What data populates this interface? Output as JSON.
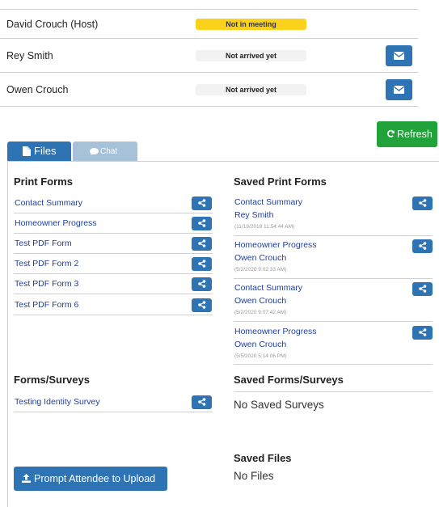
{
  "attendees": [
    {
      "name": "David Crouch (Host)",
      "status": "Not in meeting",
      "status_color": "#fbd21b",
      "has_mail": false
    },
    {
      "name": "Rey Smith",
      "status": "Not arrived yet",
      "status_color": "#f2f2f2",
      "has_mail": true
    },
    {
      "name": "Owen Crouch",
      "status": "Not arrived yet",
      "status_color": "#f2f2f2",
      "has_mail": true
    }
  ],
  "toolbar": {
    "refresh_label": "Refresh"
  },
  "tabs": [
    {
      "label": "Files",
      "icon": "file-icon",
      "active": true
    },
    {
      "label": "Chat",
      "icon": "chat-bubble-icon",
      "active": false
    }
  ],
  "print_forms": {
    "title": "Print Forms",
    "items": [
      "Contact Summary",
      "Homeowner Progress",
      "Test PDF Form",
      "Test PDF Form 2",
      "Test PDF Form 3",
      "Test PDF Form 6"
    ]
  },
  "saved_print_forms": {
    "title": "Saved Print Forms",
    "items": [
      {
        "form": "Contact Summary",
        "person": "Rey Smith",
        "timestamp": "(11/19/2019 11:54:44 AM)"
      },
      {
        "form": "Homeowner Progress",
        "person": "Owen Crouch",
        "timestamp": "(5/2/2020 9:02:33 AM)"
      },
      {
        "form": "Contact Summary",
        "person": "Owen Crouch",
        "timestamp": "(5/2/2020 9:07:42 AM)"
      },
      {
        "form": "Homeowner Progress",
        "person": "Owen Crouch",
        "timestamp": "(5/5/2020 5:14:06 PM)"
      }
    ]
  },
  "forms_surveys": {
    "title": "Forms/Surveys",
    "items": [
      "Testing Identity Survey"
    ]
  },
  "saved_forms_surveys": {
    "title": "Saved Forms/Surveys",
    "empty_text": "No Saved Surveys"
  },
  "saved_files": {
    "title": "Saved Files",
    "empty_text": "No Files"
  },
  "upload": {
    "label": "Prompt Attendee to Upload"
  },
  "colors": {
    "primary": "#2e74b5",
    "success": "#21a23a",
    "link": "#1f3f9a",
    "warning": "#fbd21b",
    "tab_inactive": "#a7c1d8"
  }
}
